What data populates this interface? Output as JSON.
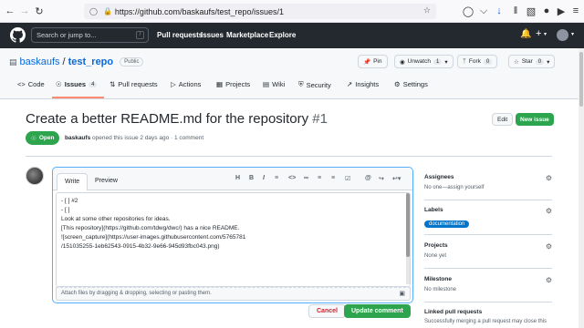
{
  "browser": {
    "url": "https://github.com/baskaufs/test_repo/issues/1"
  },
  "header": {
    "search_placeholder": "Search or jump to...",
    "search_key": "/",
    "nav": [
      "Pull requests",
      "Issues",
      "Marketplace",
      "Explore"
    ]
  },
  "repo": {
    "owner": "baskaufs",
    "sep": "/",
    "name": "test_repo",
    "visibility": "Public",
    "pin_label": "Pin",
    "unwatch_label": "Unwatch",
    "unwatch_count": "1",
    "fork_label": "Fork",
    "fork_count": "0",
    "star_label": "Star",
    "star_count": "0",
    "tabs": [
      {
        "label": "Code"
      },
      {
        "label": "Issues",
        "count": "4"
      },
      {
        "label": "Pull requests"
      },
      {
        "label": "Actions"
      },
      {
        "label": "Projects"
      },
      {
        "label": "Wiki"
      },
      {
        "label": "Security"
      },
      {
        "label": "Insights"
      },
      {
        "label": "Settings"
      }
    ]
  },
  "issue": {
    "title": "Create a better README.md for the repository",
    "number": "#1",
    "edit_label": "Edit",
    "new_issue_label": "New issue",
    "status": "Open",
    "author": "baskaufs",
    "meta_text": "opened this issue 2 days ago · 1 comment"
  },
  "editor": {
    "tab_write": "Write",
    "tab_preview": "Preview",
    "lines": [
      "- [ ] #2",
      "- [ ]",
      "",
      "Look at some other repositories for ideas.",
      "",
      "[This repository](https://github.com/tdwg/dwc/) has a nice README.",
      "",
      "![screen_capture](https://user-images.githubusercontent.com/5765781",
      "/151035255-1eb62543-0915-4b32-9e66-945d93fbc043.png)"
    ],
    "attach_text": "Attach files by dragging & dropping, selecting or pasting them.",
    "cancel_label": "Cancel",
    "update_label": "Update comment"
  },
  "sidebar": {
    "assignees_title": "Assignees",
    "assignees_value": "No one—assign yourself",
    "labels_title": "Labels",
    "label_name": "documentation",
    "projects_title": "Projects",
    "projects_value": "None yet",
    "milestone_title": "Milestone",
    "milestone_value": "No milestone",
    "linked_title": "Linked pull requests",
    "linked_value": "Successfully merging a pull request may close this"
  }
}
